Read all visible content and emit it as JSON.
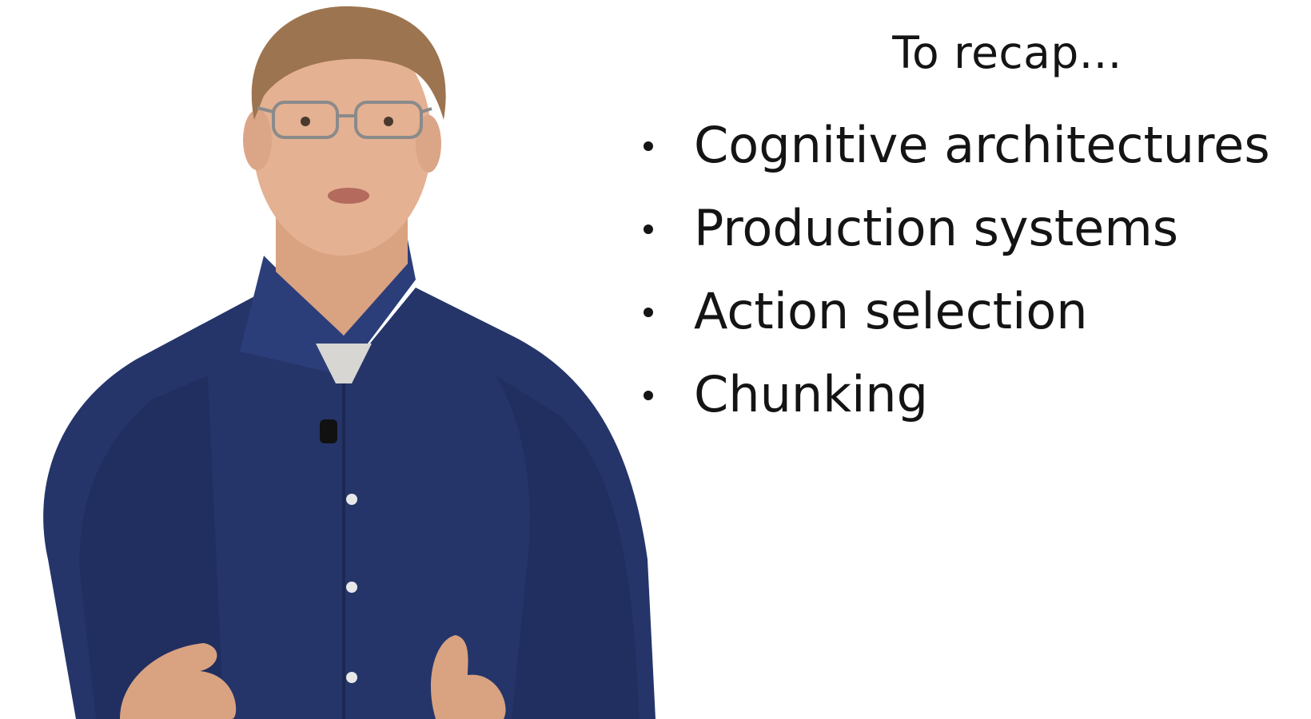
{
  "slide": {
    "title": "To recap...",
    "bullets": [
      "Cognitive architectures",
      "Production systems",
      "Action selection",
      "Chunking"
    ]
  },
  "colors": {
    "background": "#ffffff",
    "text": "#141414",
    "shirt": "#25356a",
    "skin": "#e4b193",
    "hair": "#9d7450"
  }
}
